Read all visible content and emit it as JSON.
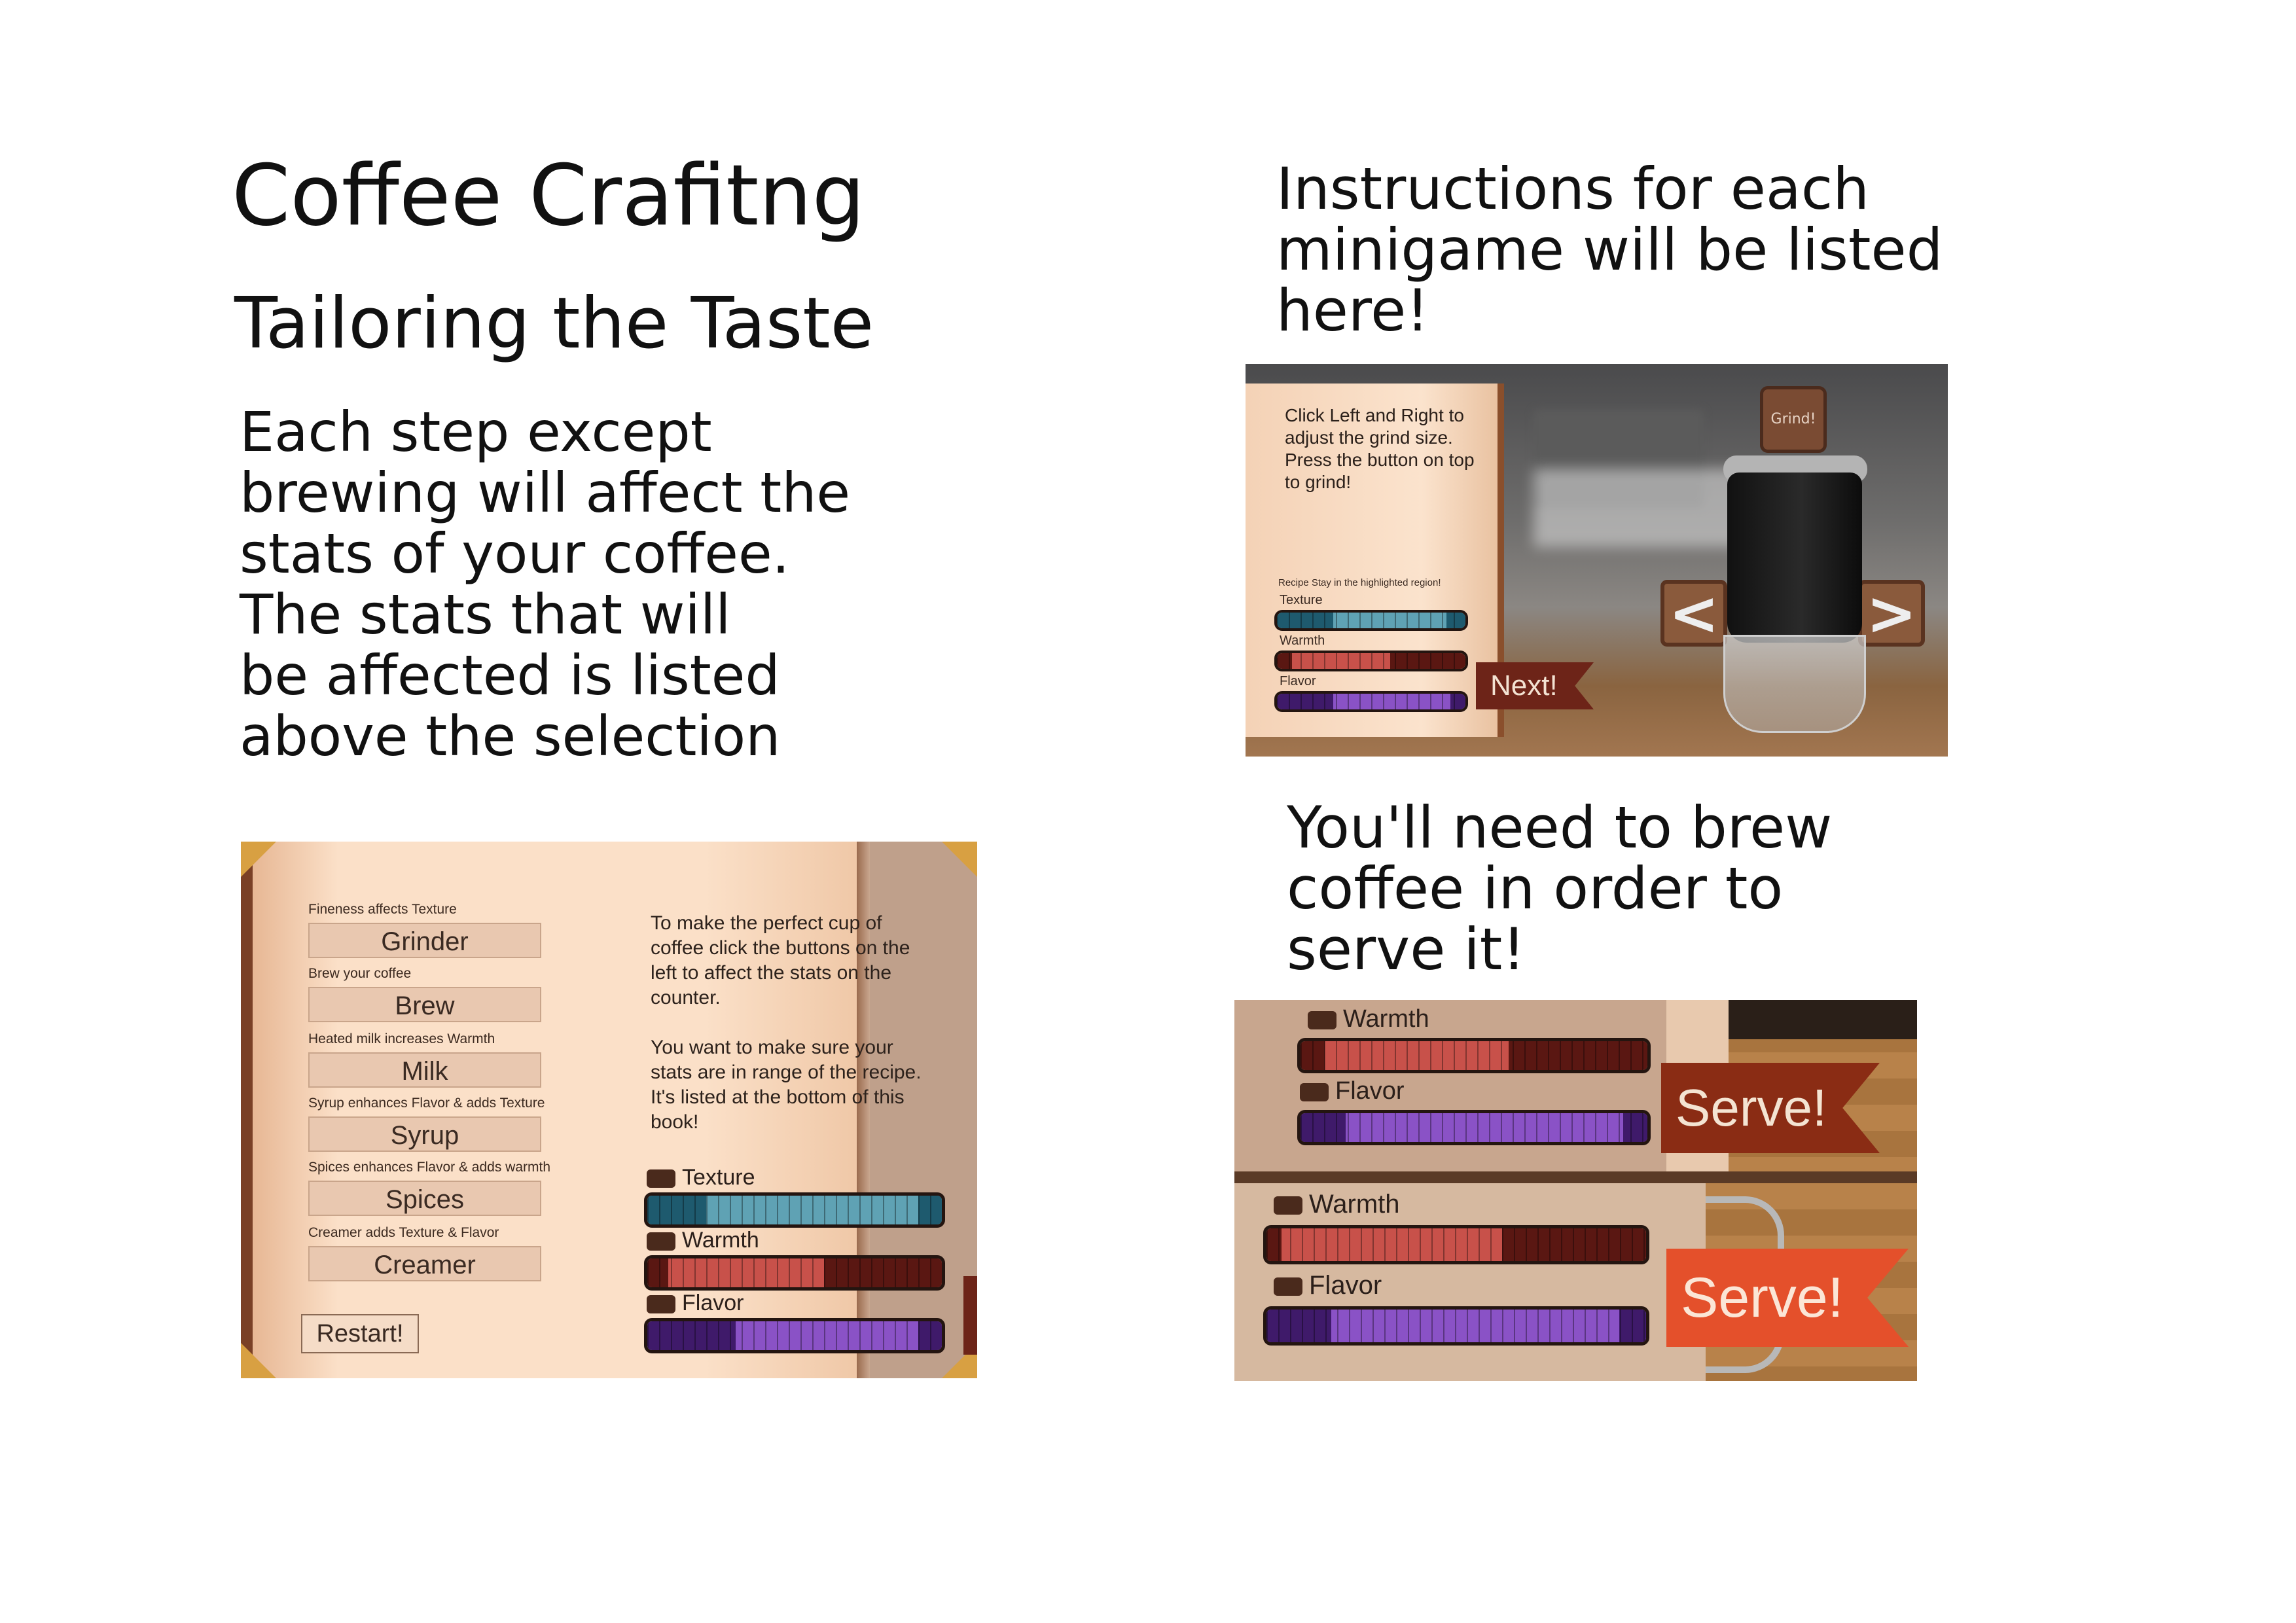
{
  "title": "Coffee Crafitng",
  "subtitle": "Tailoring the Taste",
  "description_lines": [
    "Each step except",
    "brewing will affect the",
    "stats of your coffee.",
    "The stats that will",
    "be affected is listed",
    "above the selection"
  ],
  "minigame_note_lines": [
    "Instructions for each",
    "minigame will be listed",
    "here!"
  ],
  "brew_note_lines": [
    "You'll need to brew",
    "coffee in order to",
    "serve it!"
  ],
  "book": {
    "options": [
      {
        "hint": "Fineness affects Texture",
        "label": "Grinder"
      },
      {
        "hint": "Brew your coffee",
        "label": "Brew"
      },
      {
        "hint": "Heated milk increases Warmth",
        "label": "Milk"
      },
      {
        "hint": "Syrup enhances Flavor & adds Texture",
        "label": "Syrup"
      },
      {
        "hint": "Spices enhances Flavor & adds warmth",
        "label": "Spices"
      },
      {
        "hint": "Creamer adds Texture & Flavor",
        "label": "Creamer"
      }
    ],
    "restart_label": "Restart!",
    "instructions_1": "To make the perfect cup of coffee click the buttons on the left to affect the stats on the counter.",
    "instructions_2": "You want to make sure your stats are in range of the recipe. It's listed at the bottom of this book!",
    "stats": [
      {
        "name": "Texture",
        "icon": "knife-icon",
        "dark": "#1e5a6e",
        "light": "#5fa2b4",
        "hl_start": 0.2,
        "hl_end": 0.92
      },
      {
        "name": "Warmth",
        "icon": "cup-icon",
        "dark": "#5a1712",
        "light": "#c8514a",
        "hl_start": 0.07,
        "hl_end": 0.6
      },
      {
        "name": "Flavor",
        "icon": "beans-icon",
        "dark": "#3f1a6a",
        "light": "#8a52c6",
        "hl_start": 0.3,
        "hl_end": 0.92
      }
    ]
  },
  "grinder": {
    "instructions": "Click Left and Right to adjust the grind size. Press the button on top to grind!",
    "recipe_text": "Recipe Stay in the highlighted region!",
    "stats": [
      {
        "name": "Texture",
        "icon": "knife-icon"
      },
      {
        "name": "Warmth",
        "icon": "cup-icon"
      },
      {
        "name": "Flavor",
        "icon": "beans-icon"
      }
    ],
    "next_label": "Next!",
    "grind_label": "Grind!",
    "left_label": "<",
    "right_label": ">"
  },
  "serve": {
    "stats": [
      {
        "name": "Warmth",
        "icon": "cup-icon"
      },
      {
        "name": "Flavor",
        "icon": "beans-icon"
      }
    ],
    "serve_label": "Serve!"
  }
}
